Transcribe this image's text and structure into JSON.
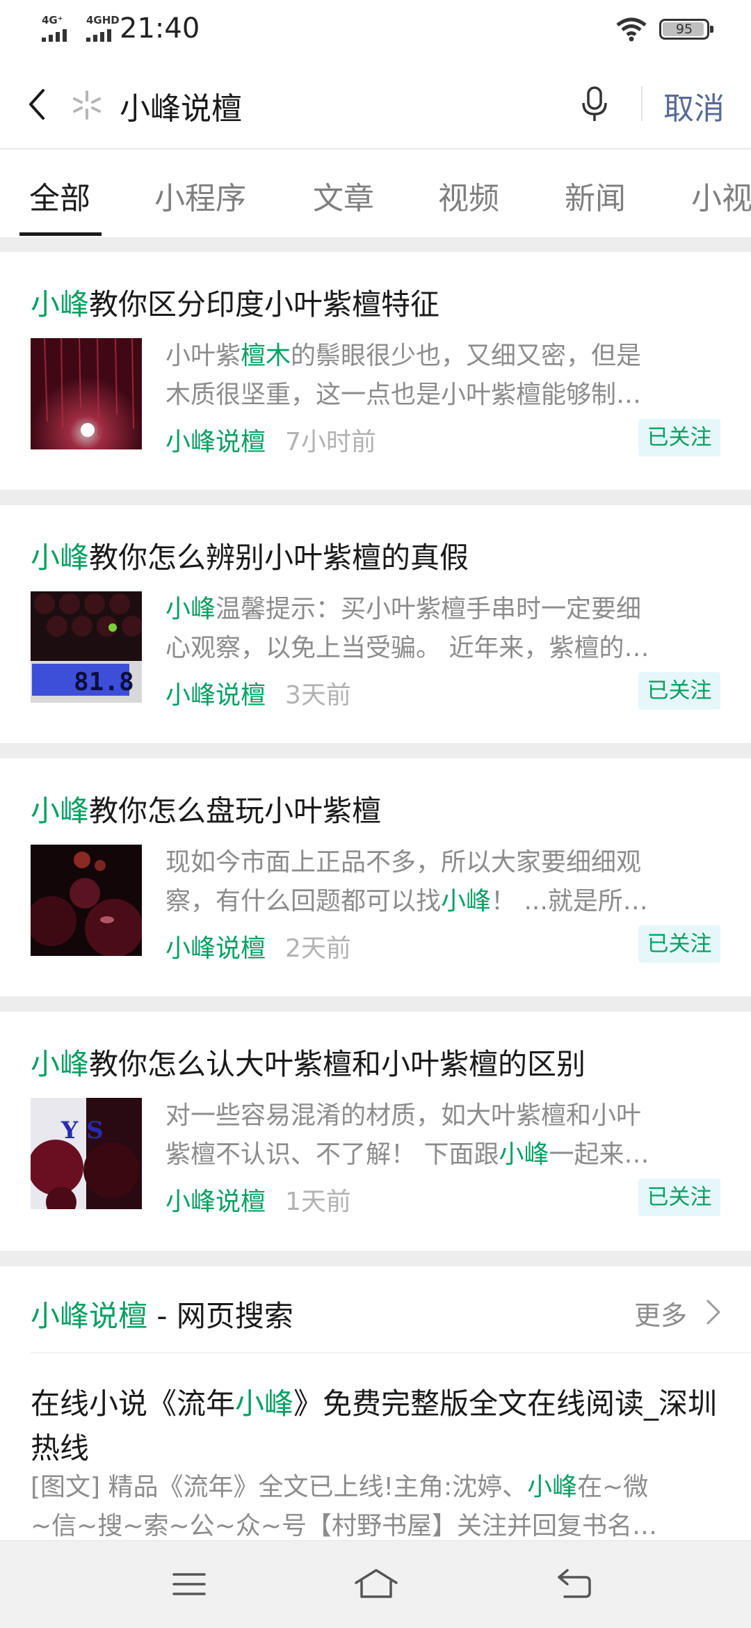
{
  "status_bar": {
    "signal1_label": "4G⁺",
    "signal2_label": "4GHD",
    "time": "21:40",
    "battery": "95",
    "battery_level": 0.95
  },
  "search": {
    "query": "小峰说檀",
    "cancel_label": "取消"
  },
  "tabs": [
    "全部",
    "小程序",
    "文章",
    "视频",
    "新闻",
    "小视"
  ],
  "articles": [
    {
      "title_hl": "小峰",
      "title_rest": "教你区分印度小叶紫檀特征",
      "snippet_l1_a": "小叶紫",
      "snippet_l1_hl": "檀木",
      "snippet_l1_b": "的鬃眼很少也，又细又密，但是",
      "snippet_l2": "木质很坚重，这一点也是小叶紫檀能够制…",
      "source": "小峰说檀",
      "time": "7小时前",
      "badge": "已关注"
    },
    {
      "title_hl": "小峰",
      "title_rest": "教你怎么辨别小叶紫檀的真假",
      "snippet_l1_hl": "小峰",
      "snippet_l1_b": "温馨提示：买小叶紫檀手串时一定要细",
      "snippet_l2": "心观察，以免上当受骗。 近年来，紫檀的…",
      "thumb_readout": "81.8",
      "source": "小峰说檀",
      "time": "3天前",
      "badge": "已关注"
    },
    {
      "title_hl": "小峰",
      "title_rest": "教你怎么盘玩小叶紫檀",
      "snippet_l1": "现如今市面上正品不多，所以大家要细细观",
      "snippet_l2_a": "察，有什么回题都可以找",
      "snippet_l2_hl": "小峰",
      "snippet_l2_b": "！ ...就是所…",
      "source": "小峰说檀",
      "time": "2天前",
      "badge": "已关注"
    },
    {
      "title_hl": "小峰",
      "title_rest": "教你怎么认大叶紫檀和小叶紫檀的区别",
      "snippet_l1": "对一些容易混淆的材质，如大叶紫檀和小叶",
      "snippet_l2_a": "紫檀不认识、不了解！ 下面跟",
      "snippet_l2_hl": "小峰",
      "snippet_l2_b": "一起来…",
      "thumb_letters": "Y S",
      "source": "小峰说檀",
      "time": "1天前",
      "badge": "已关注"
    }
  ],
  "web_search": {
    "header_hl": "小峰说檀",
    "header_rest": " - 网页搜索",
    "more_label": "更多",
    "result_title_a": "在线小说《流年",
    "result_title_hl": "小峰",
    "result_title_b": "》免费完整版全文在线阅读_深圳热线",
    "snippet_l1_a": "[图文] 精品《流年》全文已上线!主角:沈婷、",
    "snippet_l1_hl": "小峰",
    "snippet_l1_b": "在~微",
    "snippet_l2": "~信~搜~索~公~众~号【村野书屋】关注并回复书名…"
  },
  "colors": {
    "accent_green": "#07a062",
    "link_blue": "#576b95",
    "badge_bg": "#e6f7fa"
  },
  "icons": [
    "back-icon",
    "loading-icon",
    "mic-icon",
    "chevron-right-icon",
    "menu-icon",
    "home-icon",
    "return-icon",
    "wifi-icon",
    "battery-icon",
    "signal-icon"
  ]
}
